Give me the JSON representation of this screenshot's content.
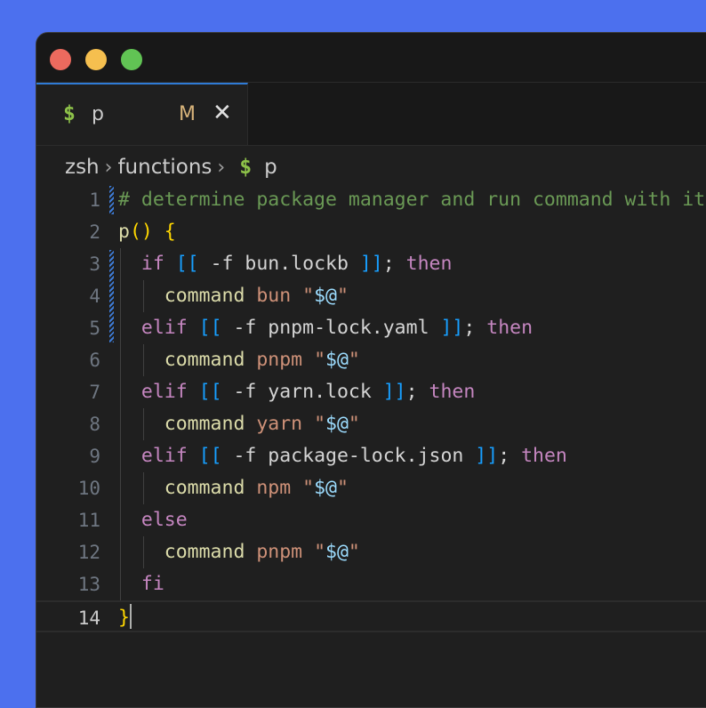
{
  "window": {
    "buttons": [
      "close",
      "minimize",
      "zoom"
    ]
  },
  "tab": {
    "icon": "$",
    "label": "p",
    "modified": "M",
    "close": "✕"
  },
  "breadcrumb": {
    "items": [
      "zsh",
      "functions"
    ],
    "separator": "›",
    "file_icon": "$",
    "file": "p"
  },
  "editor": {
    "current_line": 14,
    "lines": [
      {
        "n": "1",
        "tokens": [
          [
            "comment",
            "# determine package manager and run command with it"
          ]
        ]
      },
      {
        "n": "2",
        "tokens": [
          [
            "func",
            "p"
          ],
          [
            "paren",
            "()"
          ],
          [
            "plain",
            " "
          ],
          [
            "paren",
            "{"
          ]
        ]
      },
      {
        "n": "3",
        "tokens": [
          [
            "plain",
            "  "
          ],
          [
            "kw",
            "if"
          ],
          [
            "plain",
            " "
          ],
          [
            "bracket",
            "[["
          ],
          [
            "plain",
            " -f bun.lockb "
          ],
          [
            "bracket",
            "]]"
          ],
          [
            "plain",
            "; "
          ],
          [
            "kw",
            "then"
          ]
        ]
      },
      {
        "n": "4",
        "tokens": [
          [
            "plain",
            "    "
          ],
          [
            "cmd",
            "command"
          ],
          [
            "plain",
            " "
          ],
          [
            "arg",
            "bun"
          ],
          [
            "plain",
            " "
          ],
          [
            "str",
            "\""
          ],
          [
            "var",
            "$@"
          ],
          [
            "str",
            "\""
          ]
        ]
      },
      {
        "n": "5",
        "tokens": [
          [
            "plain",
            "  "
          ],
          [
            "kw",
            "elif"
          ],
          [
            "plain",
            " "
          ],
          [
            "bracket",
            "[["
          ],
          [
            "plain",
            " -f pnpm-lock.yaml "
          ],
          [
            "bracket",
            "]]"
          ],
          [
            "plain",
            "; "
          ],
          [
            "kw",
            "then"
          ]
        ]
      },
      {
        "n": "6",
        "tokens": [
          [
            "plain",
            "    "
          ],
          [
            "cmd",
            "command"
          ],
          [
            "plain",
            " "
          ],
          [
            "arg",
            "pnpm"
          ],
          [
            "plain",
            " "
          ],
          [
            "str",
            "\""
          ],
          [
            "var",
            "$@"
          ],
          [
            "str",
            "\""
          ]
        ]
      },
      {
        "n": "7",
        "tokens": [
          [
            "plain",
            "  "
          ],
          [
            "kw",
            "elif"
          ],
          [
            "plain",
            " "
          ],
          [
            "bracket",
            "[["
          ],
          [
            "plain",
            " -f yarn.lock "
          ],
          [
            "bracket",
            "]]"
          ],
          [
            "plain",
            "; "
          ],
          [
            "kw",
            "then"
          ]
        ]
      },
      {
        "n": "8",
        "tokens": [
          [
            "plain",
            "    "
          ],
          [
            "cmd",
            "command"
          ],
          [
            "plain",
            " "
          ],
          [
            "arg",
            "yarn"
          ],
          [
            "plain",
            " "
          ],
          [
            "str",
            "\""
          ],
          [
            "var",
            "$@"
          ],
          [
            "str",
            "\""
          ]
        ]
      },
      {
        "n": "9",
        "tokens": [
          [
            "plain",
            "  "
          ],
          [
            "kw",
            "elif"
          ],
          [
            "plain",
            " "
          ],
          [
            "bracket",
            "[["
          ],
          [
            "plain",
            " -f package-lock.json "
          ],
          [
            "bracket",
            "]]"
          ],
          [
            "plain",
            "; "
          ],
          [
            "kw",
            "then"
          ]
        ]
      },
      {
        "n": "10",
        "tokens": [
          [
            "plain",
            "    "
          ],
          [
            "cmd",
            "command"
          ],
          [
            "plain",
            " "
          ],
          [
            "arg",
            "npm"
          ],
          [
            "plain",
            " "
          ],
          [
            "str",
            "\""
          ],
          [
            "var",
            "$@"
          ],
          [
            "str",
            "\""
          ]
        ]
      },
      {
        "n": "11",
        "tokens": [
          [
            "plain",
            "  "
          ],
          [
            "kw",
            "else"
          ]
        ]
      },
      {
        "n": "12",
        "tokens": [
          [
            "plain",
            "    "
          ],
          [
            "cmd",
            "command"
          ],
          [
            "plain",
            " "
          ],
          [
            "arg",
            "pnpm"
          ],
          [
            "plain",
            " "
          ],
          [
            "str",
            "\""
          ],
          [
            "var",
            "$@"
          ],
          [
            "str",
            "\""
          ]
        ]
      },
      {
        "n": "13",
        "tokens": [
          [
            "plain",
            "  "
          ],
          [
            "kw",
            "fi"
          ]
        ]
      },
      {
        "n": "14",
        "tokens": [
          [
            "paren",
            "}"
          ]
        ]
      }
    ]
  },
  "colors": {
    "background": "#4c70ee",
    "editor_bg": "#1f1f1f",
    "comment": "#6a9955",
    "keyword": "#c586c0",
    "string": "#ce9178",
    "variable": "#9cdcfe",
    "bracket": "#179fff",
    "paren": "#ffd700",
    "tab_accent": "#2f7bd6"
  }
}
